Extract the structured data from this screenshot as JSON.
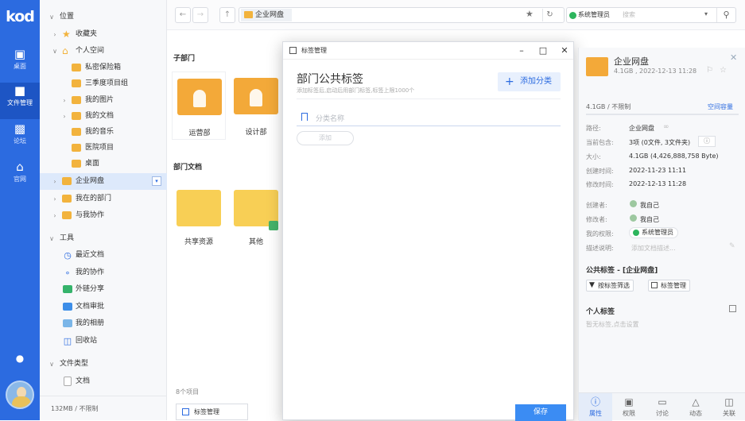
{
  "app": {
    "logo": "kod"
  },
  "rail": {
    "items": [
      {
        "label": "桌面",
        "icon": "monitor-icon"
      },
      {
        "label": "文件管理",
        "icon": "folder-icon"
      },
      {
        "label": "论坛",
        "icon": "chat-icon"
      },
      {
        "label": "官网",
        "icon": "home-icon"
      }
    ]
  },
  "tree": {
    "header_position": "位置",
    "favorites": "收藏夹",
    "personal_space": "个人空间",
    "personal_items": [
      "私密保险箱",
      "三季度项目组",
      "我的图片",
      "我的文档",
      "我的音乐",
      "医院项目",
      "桌面"
    ],
    "enterprise": "企业网盘",
    "my_dept": "我在的部门",
    "collab": "与我协作",
    "tools_header": "工具",
    "tools": [
      "最近文档",
      "我的协作",
      "外链分享",
      "文档审批",
      "我的相册",
      "回收站"
    ],
    "filetype_header": "文件类型",
    "filetype_items": [
      "文档"
    ],
    "quota": "132MB / 不限制"
  },
  "topbar": {
    "path": "企业网盘",
    "user": "系统管理员",
    "search_placeholder": "搜索"
  },
  "main": {
    "sub_dept_title": "子部门",
    "sub_depts": [
      "运营部",
      "设计部"
    ],
    "dept_docs_title": "部门文档",
    "dept_docs": [
      "共享资源",
      "其他"
    ],
    "item_count": "8个项目",
    "taskbar_label": "标签管理"
  },
  "dialog": {
    "title": "标签管理",
    "heading": "部门公共标签",
    "subtext": "添加标签后,启动后用部门标签,标签上限1000个",
    "add_category": "添加分类",
    "category_placeholder": "分类名称",
    "add_button": "添加",
    "save_button": "保存"
  },
  "info": {
    "name": "企业网盘",
    "meta": "4.1GB , 2022-12-13 11:28",
    "usage": "4.1GB / 不限制",
    "space_link": "空间容量",
    "rows": [
      {
        "k": "路径:",
        "v": "企业网盘"
      },
      {
        "k": "当前包含:",
        "v": "3项 (0文件, 3文件夹)"
      },
      {
        "k": "大小:",
        "v": "4.1GB (4,426,888,758 Byte)"
      },
      {
        "k": "创建时间:",
        "v": "2022-11-23 11:11"
      },
      {
        "k": "修改时间:",
        "v": "2022-12-13 11:28"
      }
    ],
    "rows2": [
      {
        "k": "创建者:",
        "v": "我自己"
      },
      {
        "k": "修改者:",
        "v": "我自己"
      },
      {
        "k": "我的权限:",
        "v": "系统管理员"
      },
      {
        "k": "描述说明:",
        "v": "添加文档描述..."
      }
    ],
    "public_tags_title": "公共标签 - [企业网盘]",
    "filter_btn": "按标签筛选",
    "manage_btn": "标签管理",
    "personal_tags_title": "个人标签",
    "personal_tags_hint": "暂无标签,点击设置",
    "tabs": [
      "属性",
      "权限",
      "讨论",
      "动态",
      "关联"
    ]
  },
  "colors": {
    "accent": "#2c6be0",
    "folder": "#f2b33d",
    "save": "#3b8cf3"
  }
}
